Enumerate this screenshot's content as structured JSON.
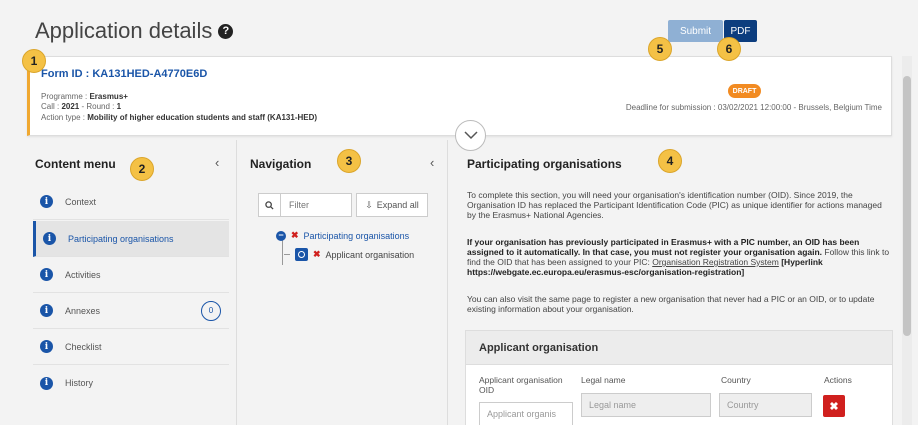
{
  "page": {
    "title": "Application details"
  },
  "toolbar": {
    "submit_label": "Submit",
    "pdf_label": "PDF"
  },
  "badges": [
    "1",
    "2",
    "3",
    "4",
    "5",
    "6"
  ],
  "form": {
    "id_label": "Form ID : KA131HED-A4770E6D",
    "programme_label": "Programme : ",
    "programme_value": "Erasmus+",
    "call_label": "Call : ",
    "call_value": "2021",
    "round_label": " - Round : ",
    "round_value": "1",
    "action_label": "Action type : ",
    "action_value": "Mobility of higher education students and staff (KA131-HED)",
    "status": "DRAFT",
    "deadline": "Deadline for submission : 03/02/2021 12:00:00 - Brussels, Belgium Time"
  },
  "content_menu": {
    "title": "Content menu",
    "items": [
      {
        "label": "Context"
      },
      {
        "label": "Participating organisations"
      },
      {
        "label": "Activities"
      },
      {
        "label": "Annexes",
        "count": "0"
      },
      {
        "label": "Checklist"
      },
      {
        "label": "History"
      }
    ]
  },
  "navigation": {
    "title": "Navigation",
    "filter_placeholder": "Filter",
    "expand_label": "Expand all",
    "tree": [
      {
        "label": "Participating organisations"
      },
      {
        "label": "Applicant organisation"
      }
    ]
  },
  "main": {
    "title": "Participating organisations",
    "para1": "To complete this section, you will need your organisation's identification number (OID). Since 2019, the Organisation ID has replaced the Participant Identification Code (PIC) as unique identifier for actions managed by the Erasmus+ National Agencies.",
    "para2_bold": "If your organisation has previously participated in Erasmus+ with a PIC number, an OID has been assigned to it automatically. In that case, you must not register your organisation again.",
    "para2_rest": " Follow this link to find the OID that has been assigned to your PIC: ",
    "para2_link": "Organisation Registration System",
    "para2_hyperlink": " [Hyperlink https://webgate.ec.europa.eu/erasmus-esc/organisation-registration]",
    "para3": "You can also visit the same page to register a new organisation that never had a PIC or an OID, or to update existing information about your organisation.",
    "applicant": {
      "header": "Applicant organisation",
      "oid_label": "Applicant organisation OID",
      "oid_placeholder": "Applicant organis",
      "legal_label": "Legal name",
      "legal_placeholder": "Legal name",
      "country_label": "Country",
      "country_placeholder": "Country",
      "actions_label": "Actions"
    }
  },
  "colors": {
    "accent": "#1a55a8",
    "draft": "#f28b22",
    "badge": "#f4c145",
    "danger": "#d0201e"
  }
}
